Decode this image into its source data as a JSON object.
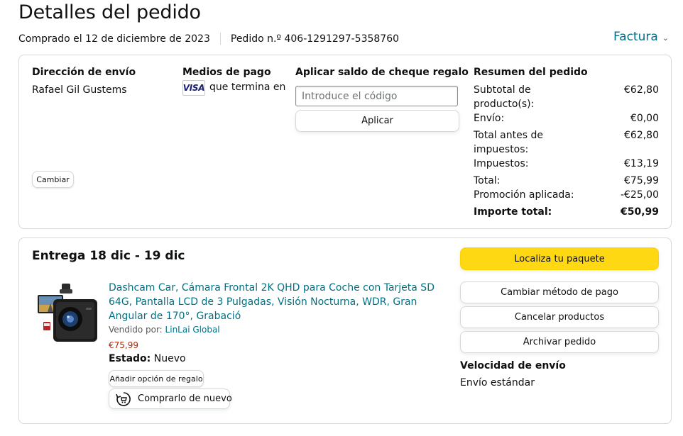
{
  "page": {
    "title": "Detalles del pedido",
    "purchased": "Comprado el 12 de diciembre de 2023",
    "order_number": "Pedido n.º 406-1291297-5358760",
    "invoice_label": "Factura"
  },
  "shipping": {
    "heading": "Dirección de envío",
    "name": "Rafael Gil Gustems",
    "change_label": "Cambiar"
  },
  "payment": {
    "heading": "Medios de pago",
    "card_brand": "VISA",
    "card_text": "que termina en"
  },
  "gift": {
    "heading": "Aplicar saldo de cheque regalo",
    "placeholder": "Introduce el código",
    "apply_label": "Aplicar"
  },
  "summary": {
    "heading": "Resumen del pedido",
    "rows": [
      {
        "label": "Subtotal de producto(s):",
        "value": "€62,80"
      },
      {
        "label": "Envío:",
        "value": "€0,00"
      },
      {
        "label": "Total antes de impuestos:",
        "value": "€62,80"
      },
      {
        "label": "Impuestos:",
        "value": "€13,19"
      },
      {
        "label": "Total:",
        "value": "€75,99"
      },
      {
        "label": "Promoción aplicada:",
        "value": "-€25,00"
      },
      {
        "label": "Importe total:",
        "value": "€50,99"
      }
    ]
  },
  "delivery": {
    "heading": "Entrega 18 dic - 19 dic",
    "product_title": "Dashcam Car, Cámara Frontal 2K QHD para Coche con Tarjeta SD 64G, Pantalla LCD de 3 Pulgadas, Visión Nocturna, WDR, Gran Angular de 170°, Grabació",
    "sold_by_label": "Vendido por:",
    "seller": "LinLai Global",
    "price": "€75,99",
    "condition_label": "Estado:",
    "condition_value": "Nuevo",
    "gift_option_label": "Añadir opción de regalo",
    "buy_again_label": "Comprarlo de nuevo",
    "product_image_icon": "dashcam-product-icon",
    "buy_again_icon": "refresh-cart-icon"
  },
  "actions": {
    "track": "Localiza tu paquete",
    "change_payment": "Cambiar método de pago",
    "cancel": "Cancelar productos",
    "archive": "Archivar pedido"
  },
  "shipping_speed": {
    "heading": "Velocidad de envío",
    "value": "Envío estándar"
  },
  "colors": {
    "link": "#007185",
    "price": "#b12704",
    "primary_button": "#ffd814",
    "border": "#d5d9d9"
  }
}
